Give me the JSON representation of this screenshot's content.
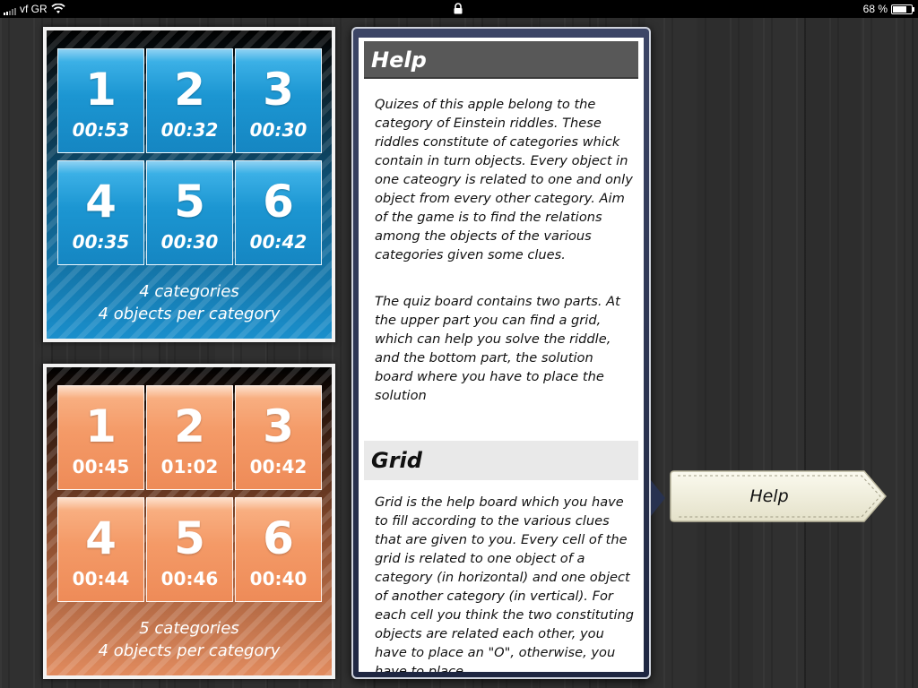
{
  "status_bar": {
    "carrier": "vf GR",
    "signal_icon": "signal-bars-icon",
    "wifi_icon": "wifi-icon",
    "lock_icon": "lock-icon",
    "battery_percent": "68 %",
    "battery_level": 0.68
  },
  "panels": [
    {
      "color": "#1c96d2",
      "tiles": [
        {
          "number": "1",
          "time": "00:53"
        },
        {
          "number": "2",
          "time": "00:32"
        },
        {
          "number": "3",
          "time": "00:30"
        },
        {
          "number": "4",
          "time": "00:35"
        },
        {
          "number": "5",
          "time": "00:30"
        },
        {
          "number": "6",
          "time": "00:42"
        }
      ],
      "caption_line1": "4 categories",
      "caption_line2": "4 objects per category"
    },
    {
      "color": "#f49a67",
      "tiles": [
        {
          "number": "1",
          "time": "00:45"
        },
        {
          "number": "2",
          "time": "01:02"
        },
        {
          "number": "3",
          "time": "00:42"
        },
        {
          "number": "4",
          "time": "00:44"
        },
        {
          "number": "5",
          "time": "00:46"
        },
        {
          "number": "6",
          "time": "00:40"
        }
      ],
      "caption_line1": "5 categories",
      "caption_line2": "4 objects per category"
    }
  ],
  "help": {
    "title": "Help",
    "paragraph1": "Quizes of this apple belong to the category of Einstein riddles. These riddles constitute of categories whick contain in turn objects. Every object in one cateogry is related to one and only object from every other category. Aim of the game is to find the relations among the objects of the various categories given some clues.",
    "paragraph2": "The quiz board contains two parts. At the upper part you can find a grid, which can help you solve the riddle, and the bottom part, the solution board where you have to place the solution",
    "grid_title": "Grid",
    "paragraph3": "Grid is the help board which you have to fill according to the various clues that are given to you. Every cell of the grid is related to one object of a category (in horizontal) and one object of another category (in vertical). For each cell you think the two constituting objects are related each other, you have to place an \"O\", otherwise, you have to place"
  },
  "help_button": {
    "label": "Help"
  }
}
